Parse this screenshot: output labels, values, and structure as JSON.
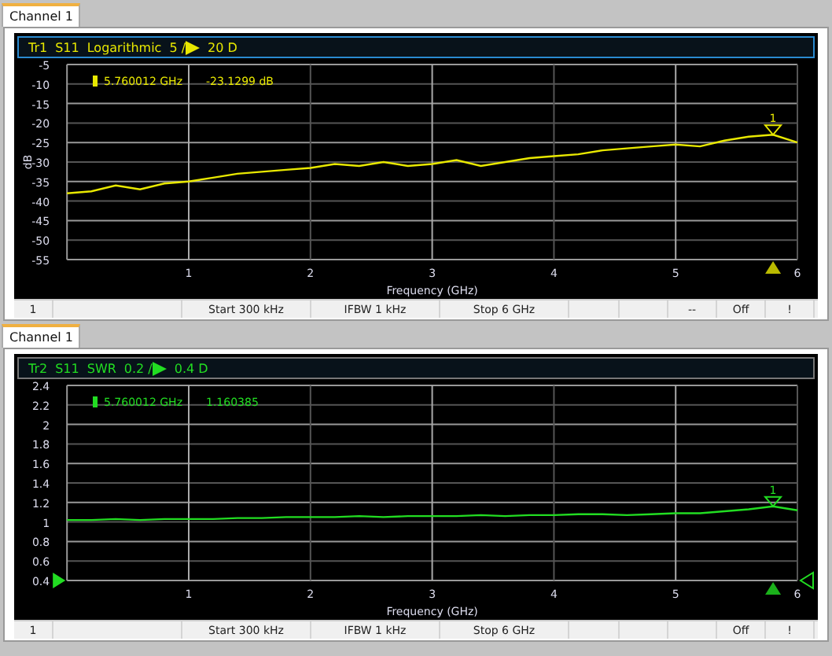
{
  "panes": [
    {
      "tab": {
        "label": "Channel 1",
        "selected": true
      },
      "header": {
        "trace": "Tr1",
        "parameter": "S11",
        "format": "Logarithmic",
        "scale": "5 /",
        "reference": "20 D",
        "active": true
      },
      "marker_readout": {
        "number": "1",
        "frequency": "5.760012 GHz",
        "value": "-23.1299 dB"
      },
      "reference_arrows": false,
      "chart_data": {
        "type": "line",
        "xlabel": "Frequency (GHz)",
        "ylabel": "dB",
        "xlim": [
          0,
          6
        ],
        "ylim": [
          -55,
          -5
        ],
        "xticks": [
          1,
          2,
          3,
          4,
          5,
          6
        ],
        "yticks": [
          -5,
          -10,
          -15,
          -20,
          -25,
          -30,
          -35,
          -40,
          -45,
          -50,
          -55
        ],
        "x": [
          0,
          0.2,
          0.4,
          0.6,
          0.8,
          1,
          1.2,
          1.4,
          1.6,
          1.8,
          2,
          2.2,
          2.4,
          2.6,
          2.8,
          3,
          3.2,
          3.4,
          3.6,
          3.8,
          4,
          4.2,
          4.4,
          4.6,
          4.8,
          5,
          5.2,
          5.4,
          5.6,
          5.8,
          6
        ],
        "grid": true,
        "series": [
          {
            "color": "#e8e800",
            "values": [
              -38,
              -37.5,
              -36,
              -37,
              -35.5,
              -35,
              -34,
              -33,
              -32.5,
              -32,
              -31.5,
              -30.5,
              -31,
              -30,
              -31,
              -30.5,
              -29.5,
              -31,
              -30,
              -29,
              -28.5,
              -28,
              -27,
              -26.5,
              -26,
              -25.5,
              -26,
              -24.5,
              -23.5,
              -23,
              -25
            ]
          }
        ]
      },
      "status_bar": [
        {
          "kind": "text",
          "text": "1"
        },
        {
          "kind": "blank"
        },
        {
          "kind": "text",
          "text": "Start 300 kHz"
        },
        {
          "kind": "text",
          "text": "IFBW 1 kHz"
        },
        {
          "kind": "text",
          "text": "Stop 6 GHz"
        },
        {
          "kind": "blank"
        },
        {
          "kind": "blank"
        },
        {
          "kind": "text",
          "text": "--"
        },
        {
          "kind": "text",
          "text": "Off"
        },
        {
          "kind": "text",
          "text": "!"
        }
      ]
    },
    {
      "tab": {
        "label": "Channel 1",
        "selected": true
      },
      "header": {
        "trace": "Tr2",
        "parameter": "S11",
        "format": "SWR",
        "scale": "0.2 /",
        "reference": "0.4 D",
        "active": false
      },
      "marker_readout": {
        "number": "1",
        "frequency": "5.760012 GHz",
        "value": "1.160385"
      },
      "reference_arrows": true,
      "chart_data": {
        "type": "line",
        "xlabel": "Frequency (GHz)",
        "xlim": [
          0,
          6
        ],
        "ylim": [
          0.4,
          2.4
        ],
        "xticks": [
          1,
          2,
          3,
          4,
          5,
          6
        ],
        "yticks": [
          2.4,
          2.2,
          2,
          1.8,
          1.6,
          1.4,
          1.2,
          1,
          0.8,
          0.6,
          0.4
        ],
        "x": [
          0,
          0.2,
          0.4,
          0.6,
          0.8,
          1,
          1.2,
          1.4,
          1.6,
          1.8,
          2,
          2.2,
          2.4,
          2.6,
          2.8,
          3,
          3.2,
          3.4,
          3.6,
          3.8,
          4,
          4.2,
          4.4,
          4.6,
          4.8,
          5,
          5.2,
          5.4,
          5.6,
          5.8,
          6
        ],
        "grid": true,
        "series": [
          {
            "color": "#22dd22",
            "values": [
              1.02,
              1.02,
              1.03,
              1.02,
              1.03,
              1.03,
              1.03,
              1.04,
              1.04,
              1.05,
              1.05,
              1.05,
              1.06,
              1.05,
              1.06,
              1.06,
              1.06,
              1.07,
              1.06,
              1.07,
              1.07,
              1.08,
              1.08,
              1.07,
              1.08,
              1.09,
              1.09,
              1.11,
              1.13,
              1.16,
              1.12
            ]
          }
        ]
      },
      "status_bar": [
        {
          "kind": "text",
          "text": "1"
        },
        {
          "kind": "blank"
        },
        {
          "kind": "text",
          "text": "Start 300 kHz"
        },
        {
          "kind": "text",
          "text": "IFBW 1 kHz"
        },
        {
          "kind": "text",
          "text": "Stop 6 GHz"
        },
        {
          "kind": "blank"
        },
        {
          "kind": "blank"
        },
        {
          "kind": "blank"
        },
        {
          "kind": "text",
          "text": "Off"
        },
        {
          "kind": "text",
          "text": "!"
        }
      ]
    }
  ]
}
